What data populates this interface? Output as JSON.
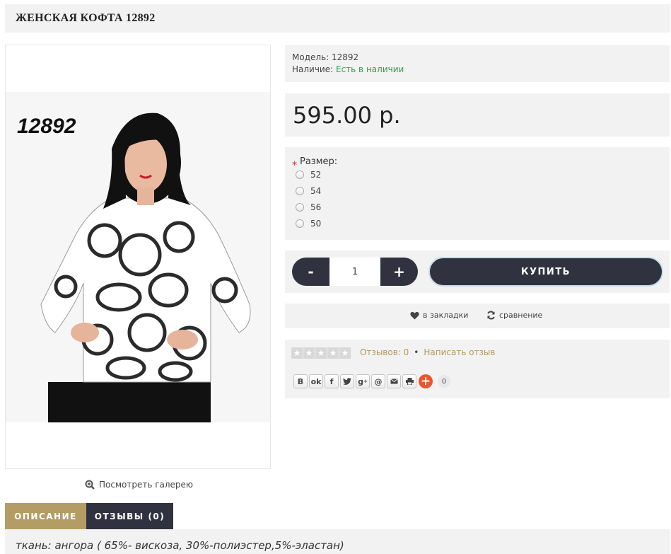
{
  "product": {
    "title": "ЖЕНСКАЯ КОФТА 12892",
    "photo_label": "12892",
    "gallery_link": "Посмотреть галерею"
  },
  "info": {
    "model_label": "Модель:",
    "model_value": "12892",
    "stock_label": "Наличие:",
    "stock_value": "Есть в наличии",
    "stock_color": "#3a9a4f"
  },
  "price": "595.00 р.",
  "options": {
    "label": "Размер:",
    "required_mark": "*",
    "sizes": [
      "52",
      "54",
      "56",
      "50"
    ]
  },
  "cart": {
    "minus": "-",
    "plus": "+",
    "quantity": "1",
    "buy_label": "КУПИТЬ"
  },
  "actions": {
    "wishlist": "в закладки",
    "compare": "сравнение"
  },
  "rating": {
    "reviews_count": "Отзывов: 0",
    "separator": "•",
    "write_review": "Написать отзыв"
  },
  "share": {
    "icons": [
      "vk-icon",
      "odnoklassniki-icon",
      "facebook-icon",
      "twitter-icon",
      "google-plus-icon",
      "mailru-icon",
      "email-icon",
      "print-icon"
    ],
    "count": "0"
  },
  "tabs": {
    "description": "ОПИСАНИЕ",
    "reviews": "ОТЗЫВЫ (0)"
  },
  "description": "ткань: ангора ( 65%- вискоза, 30%-полиэстер,5%-эластан)",
  "colors": {
    "accent": "#b39d64",
    "dark": "#30323f",
    "panel_bg": "#f2f2f2"
  }
}
